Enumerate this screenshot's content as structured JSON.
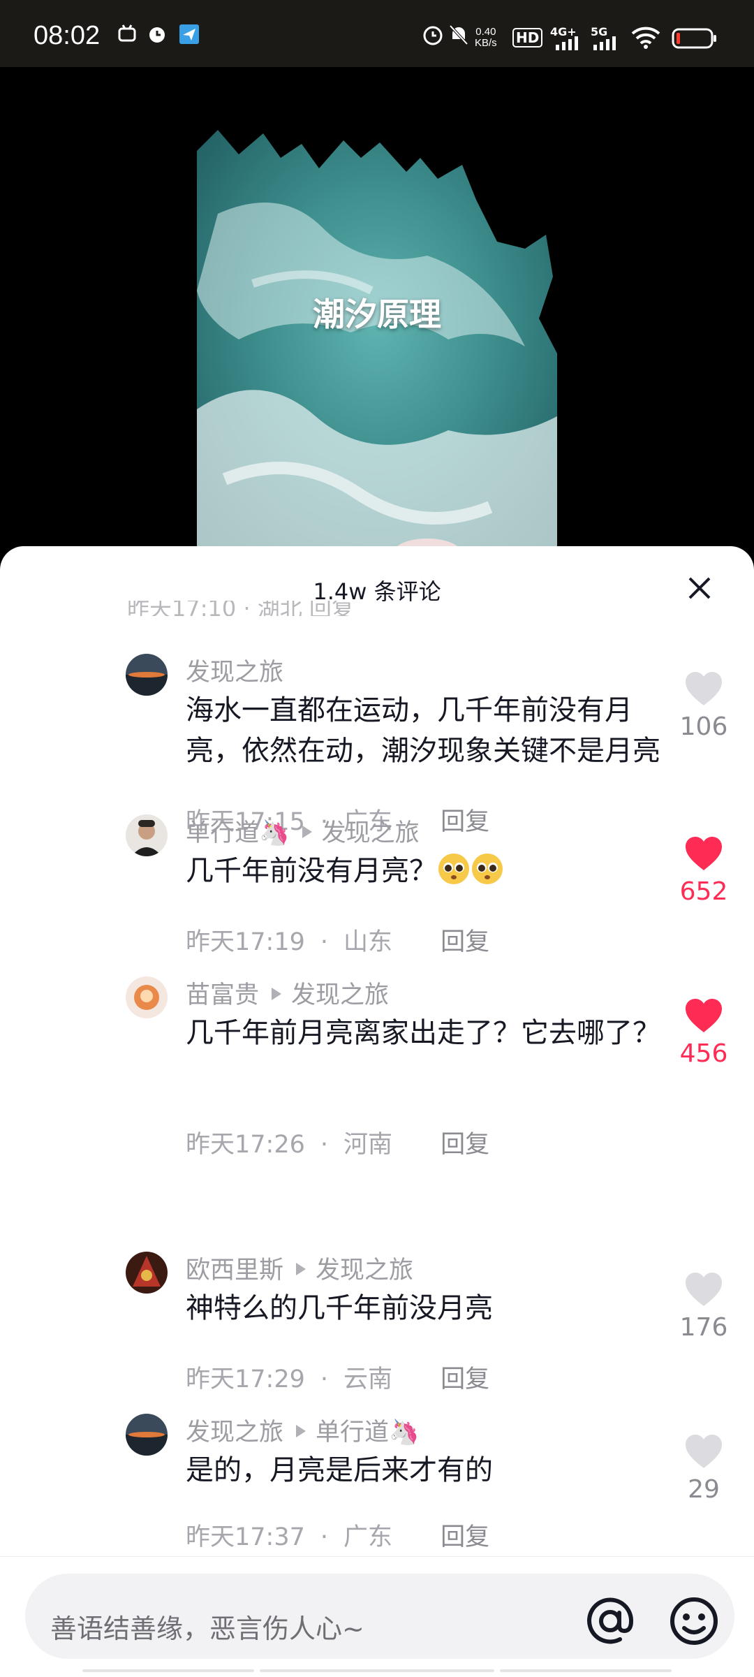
{
  "status_bar": {
    "time": "08:02",
    "net_speed": "0.40",
    "net_unit": "KB/s",
    "signal1": "4G+",
    "signal2": "5G",
    "hd": "HD"
  },
  "video": {
    "title": "潮汐原理"
  },
  "sheet": {
    "comment_count": "1.4w 条评论",
    "partial_row": "昨天17:10 · 湖北 回复"
  },
  "comments": [
    {
      "user": "发现之旅",
      "reply_to": "",
      "text": "海水一直都在运动，几千年前没有月亮，依然在动，潮汐现象关键不是月亮",
      "time": "昨天17:15",
      "region": "广东",
      "reply_label": "回复",
      "likes": "106",
      "liked": false
    },
    {
      "user": "单行道🦄",
      "reply_to": "发现之旅",
      "text": "几千年前没有月亮？",
      "time": "昨天17:19",
      "region": "山东",
      "reply_label": "回复",
      "likes": "652",
      "liked": true
    },
    {
      "user": "苗富贵",
      "reply_to": "发现之旅",
      "text": "几千年前月亮离家出走了？它去哪了？",
      "time": "昨天17:26",
      "region": "河南",
      "reply_label": "回复",
      "likes": "456",
      "liked": true
    },
    {
      "user": "欧西里斯",
      "reply_to": "发现之旅",
      "text": "神特么的几千年前没月亮",
      "time": "昨天17:29",
      "region": "云南",
      "reply_label": "回复",
      "likes": "176",
      "liked": false
    },
    {
      "user": "发现之旅",
      "reply_to": "单行道🦄",
      "text": "是的，月亮是后来才有的",
      "time": "昨天17:37",
      "region": "广东",
      "reply_label": "回复",
      "likes": "29",
      "liked": false
    }
  ],
  "input": {
    "placeholder": "善语结善缘，恶言伤人心~"
  },
  "colors": {
    "like_red": "#fe2c55",
    "text_dark": "#161823",
    "text_gray": "#9c9ca3"
  }
}
